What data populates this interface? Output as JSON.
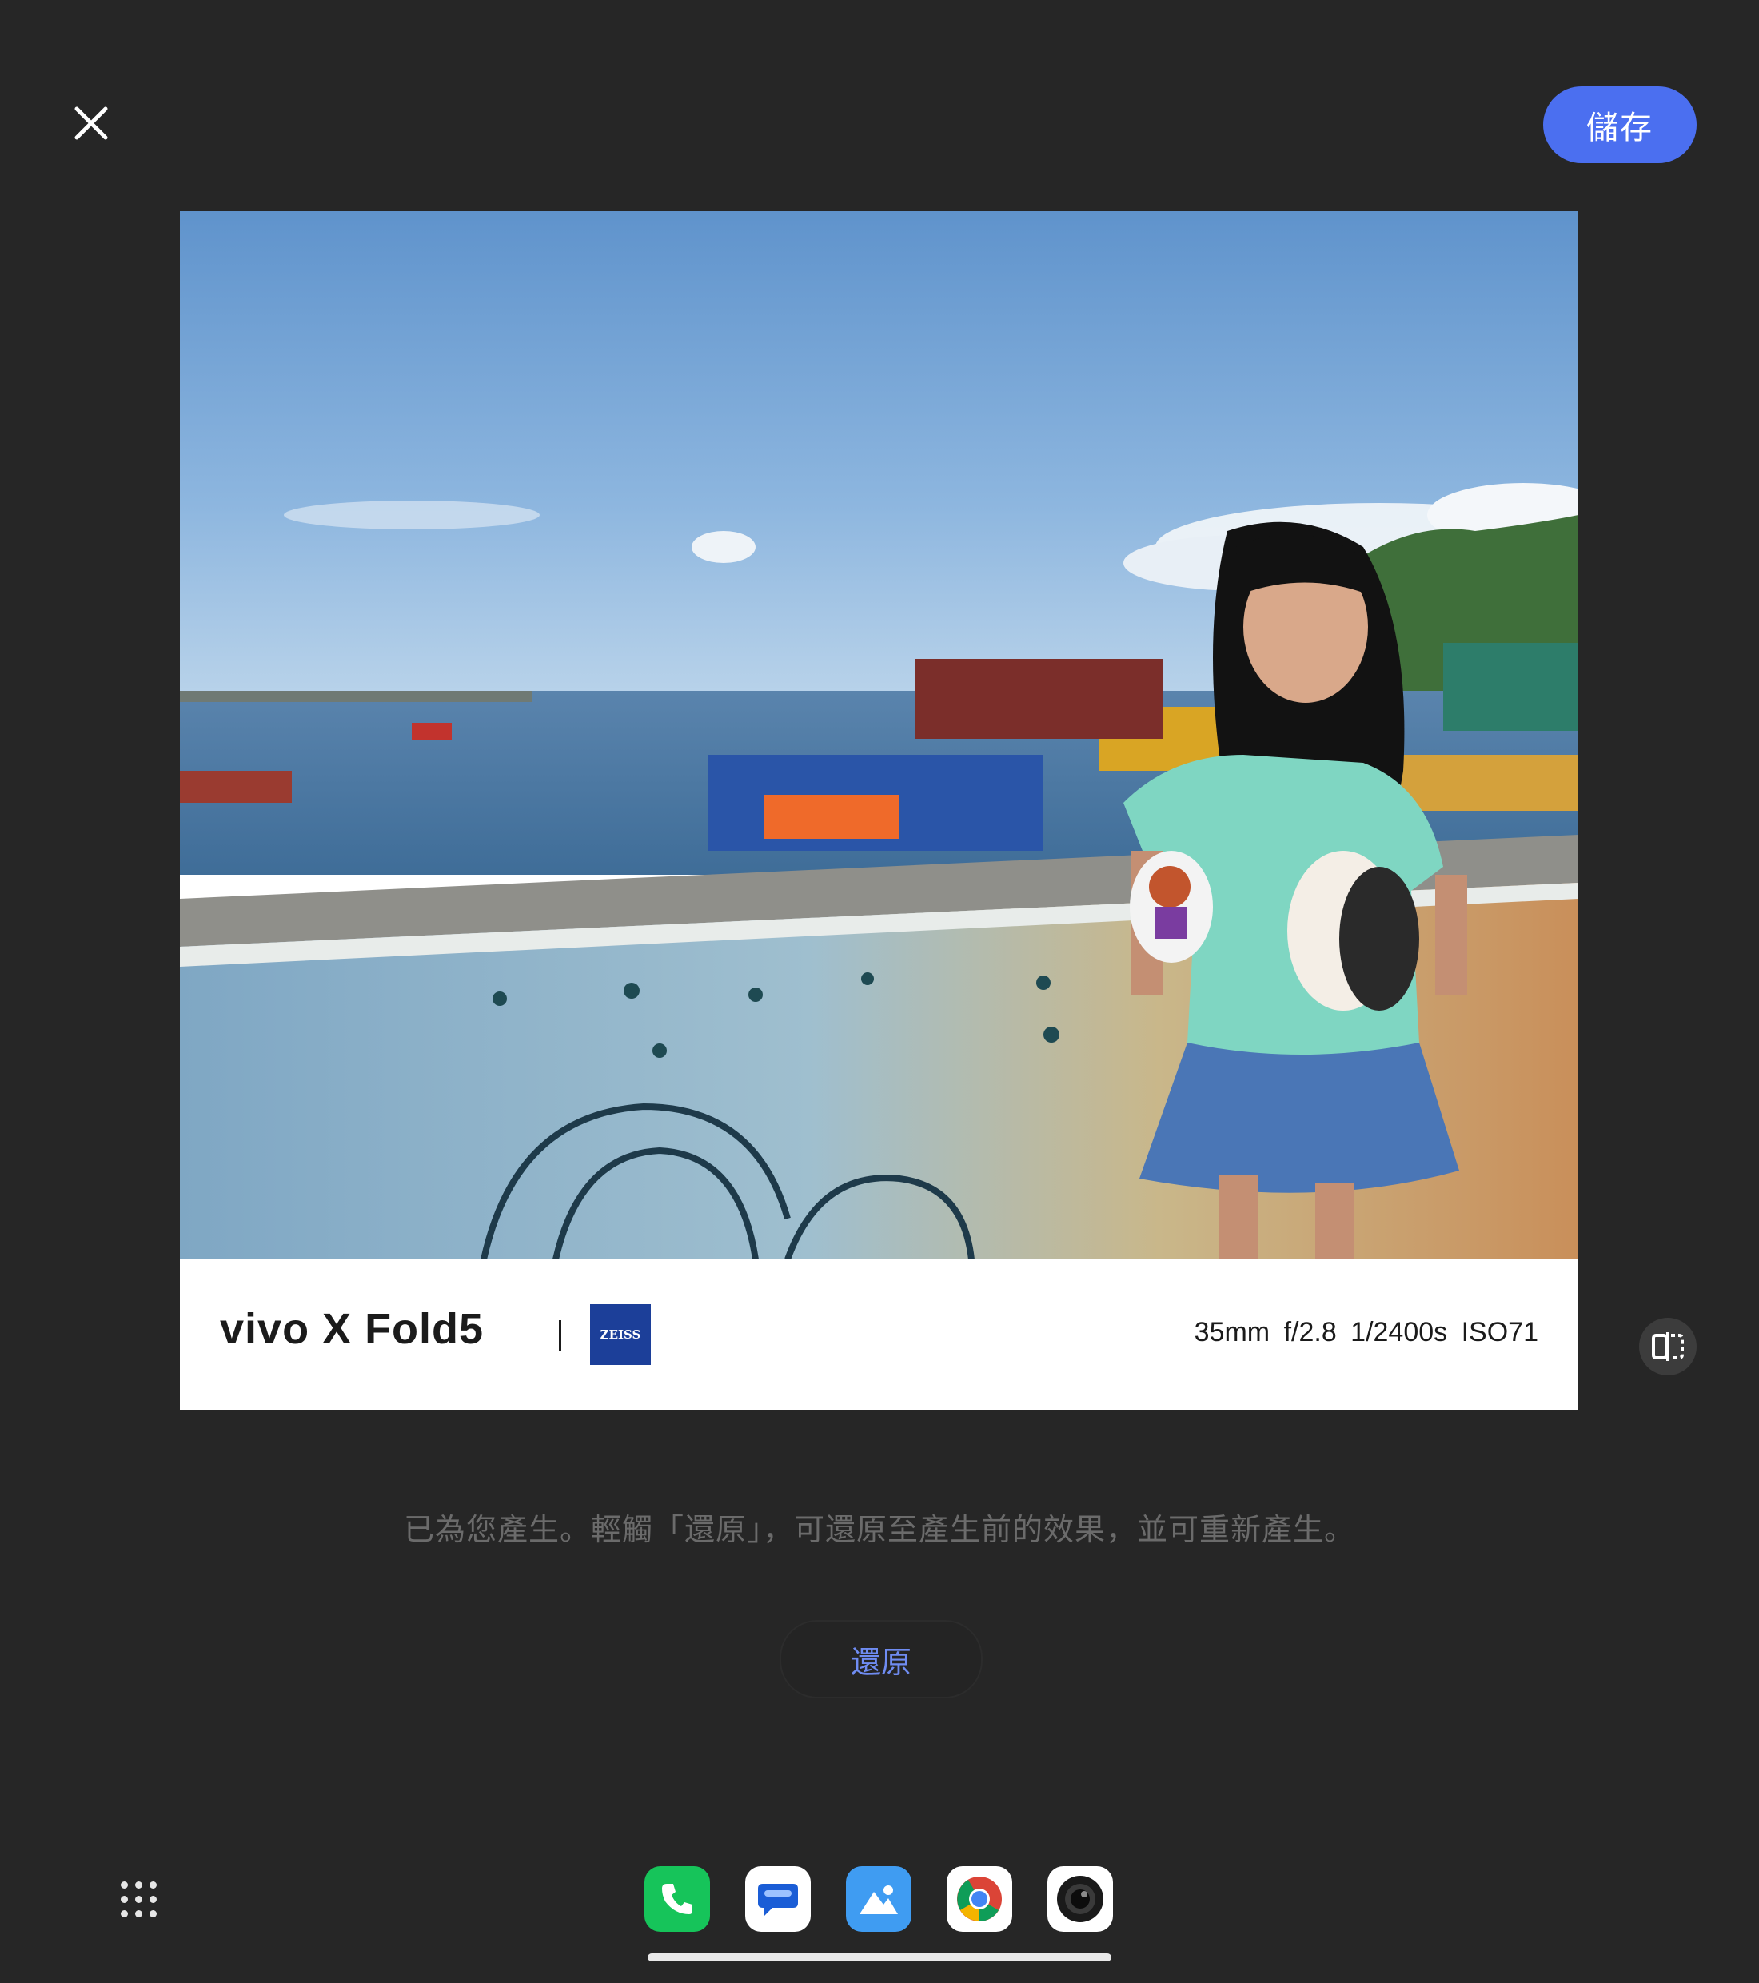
{
  "header": {
    "close_icon": "close-icon",
    "save_label": "儲存",
    "accent_color": "#4b6ff0"
  },
  "photo": {
    "watermark": {
      "brand": "vivo X Fold5",
      "divider": "|",
      "lens_logo": "ZEISS",
      "exif": "35mm  f/2.8  1/2400s  ISO71"
    }
  },
  "compare": {
    "icon": "compare-icon"
  },
  "hint": "已為您產生。輕觸「還原」，可還原至產生前的效果，並可重新產生。",
  "restore_label": "還原",
  "dock": {
    "apps": [
      {
        "name": "phone",
        "icon": "phone-icon",
        "color": "#16c45a"
      },
      {
        "name": "messages",
        "icon": "messages-icon",
        "color": "#ffffff"
      },
      {
        "name": "gallery",
        "icon": "gallery-icon",
        "color": "#3f9cf2"
      },
      {
        "name": "chrome",
        "icon": "chrome-icon",
        "color": "#ffffff"
      },
      {
        "name": "camera",
        "icon": "camera-icon",
        "color": "#ffffff"
      }
    ]
  }
}
